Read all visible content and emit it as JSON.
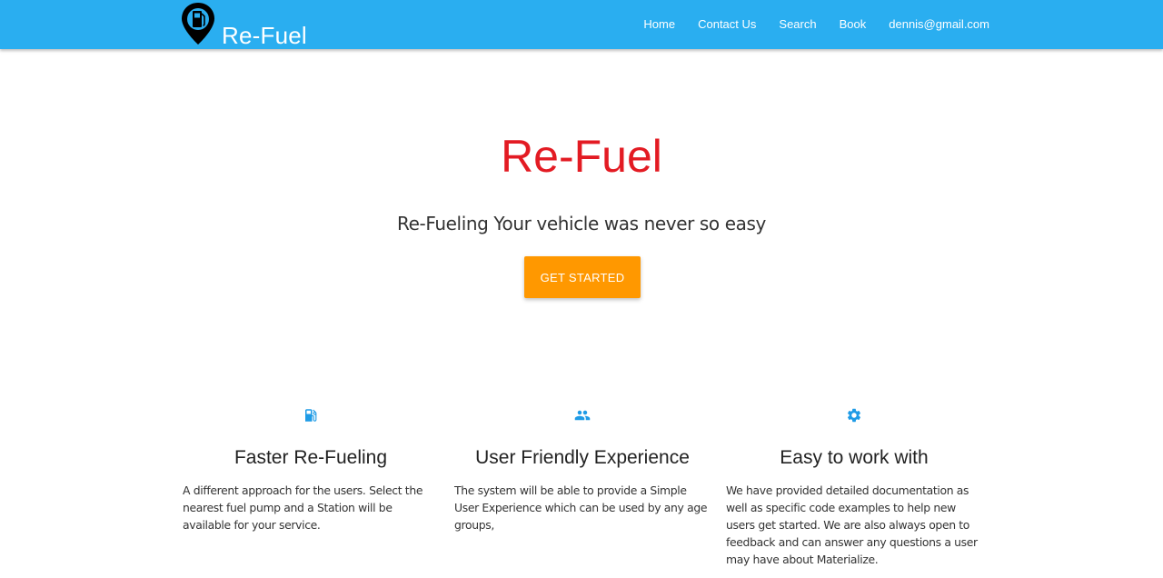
{
  "nav": {
    "brand": "Re-Fuel",
    "brand_logo_icon": "fuel-pin-icon",
    "links": [
      "Home",
      "Contact Us",
      "Search",
      "Book",
      "dennis@gmail.com"
    ]
  },
  "hero": {
    "title": "Re-Fuel",
    "subtitle": "Re-Fueling Your vehicle was never so easy",
    "cta_label": "GET STARTED"
  },
  "features": [
    {
      "icon": "fuel-station-icon",
      "title": "Faster Re-Fueling",
      "text": "A different approach for the users. Select the nearest fuel pump and a Station will be available for your service."
    },
    {
      "icon": "group-icon",
      "title": "User Friendly Experience",
      "text": "The system will be able to provide a Simple User Experience which can be used by any age groups,"
    },
    {
      "icon": "gear-icon",
      "title": "Easy to work with",
      "text": "We have provided detailed documentation as well as specific code examples to help new users get started. We are also always open to feedback and can answer any questions a user may have about Materialize."
    }
  ],
  "colors": {
    "navbar": "#2aaef0",
    "hero_title": "#e31b23",
    "cta": "#ff9800",
    "icon": "#1e9be6"
  }
}
